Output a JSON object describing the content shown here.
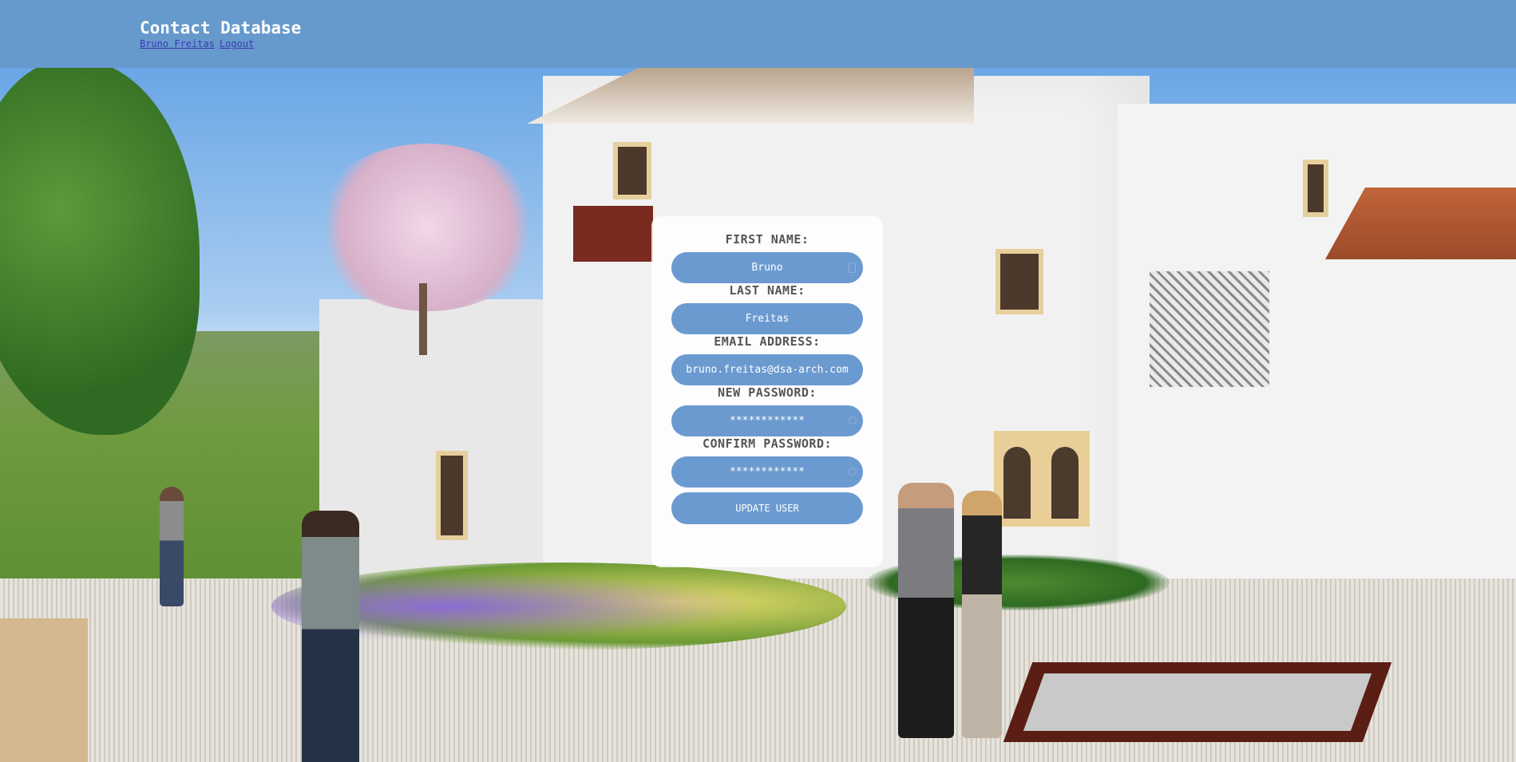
{
  "header": {
    "title": "Contact Database",
    "user_link": "Bruno Freitas",
    "logout_link": "Logout"
  },
  "form": {
    "first_name": {
      "label": "FIRST NAME:",
      "value": "Bruno"
    },
    "last_name": {
      "label": "LAST NAME:",
      "value": "Freitas"
    },
    "email": {
      "label": "EMAIL ADDRESS:",
      "value": "bruno.freitas@dsa-arch.com"
    },
    "new_password": {
      "label": "NEW PASSWORD:",
      "value": "************"
    },
    "confirm_password": {
      "label": "CONFIRM PASSWORD:",
      "value": "************"
    },
    "submit_label": "UPDATE USER"
  },
  "colors": {
    "header_bg": "#6699cc",
    "input_bg": "#6b9ad0",
    "label_text": "#555555"
  },
  "icons": {
    "first_name": "id-card-icon",
    "new_password": "key-icon",
    "confirm_password": "key-icon"
  }
}
